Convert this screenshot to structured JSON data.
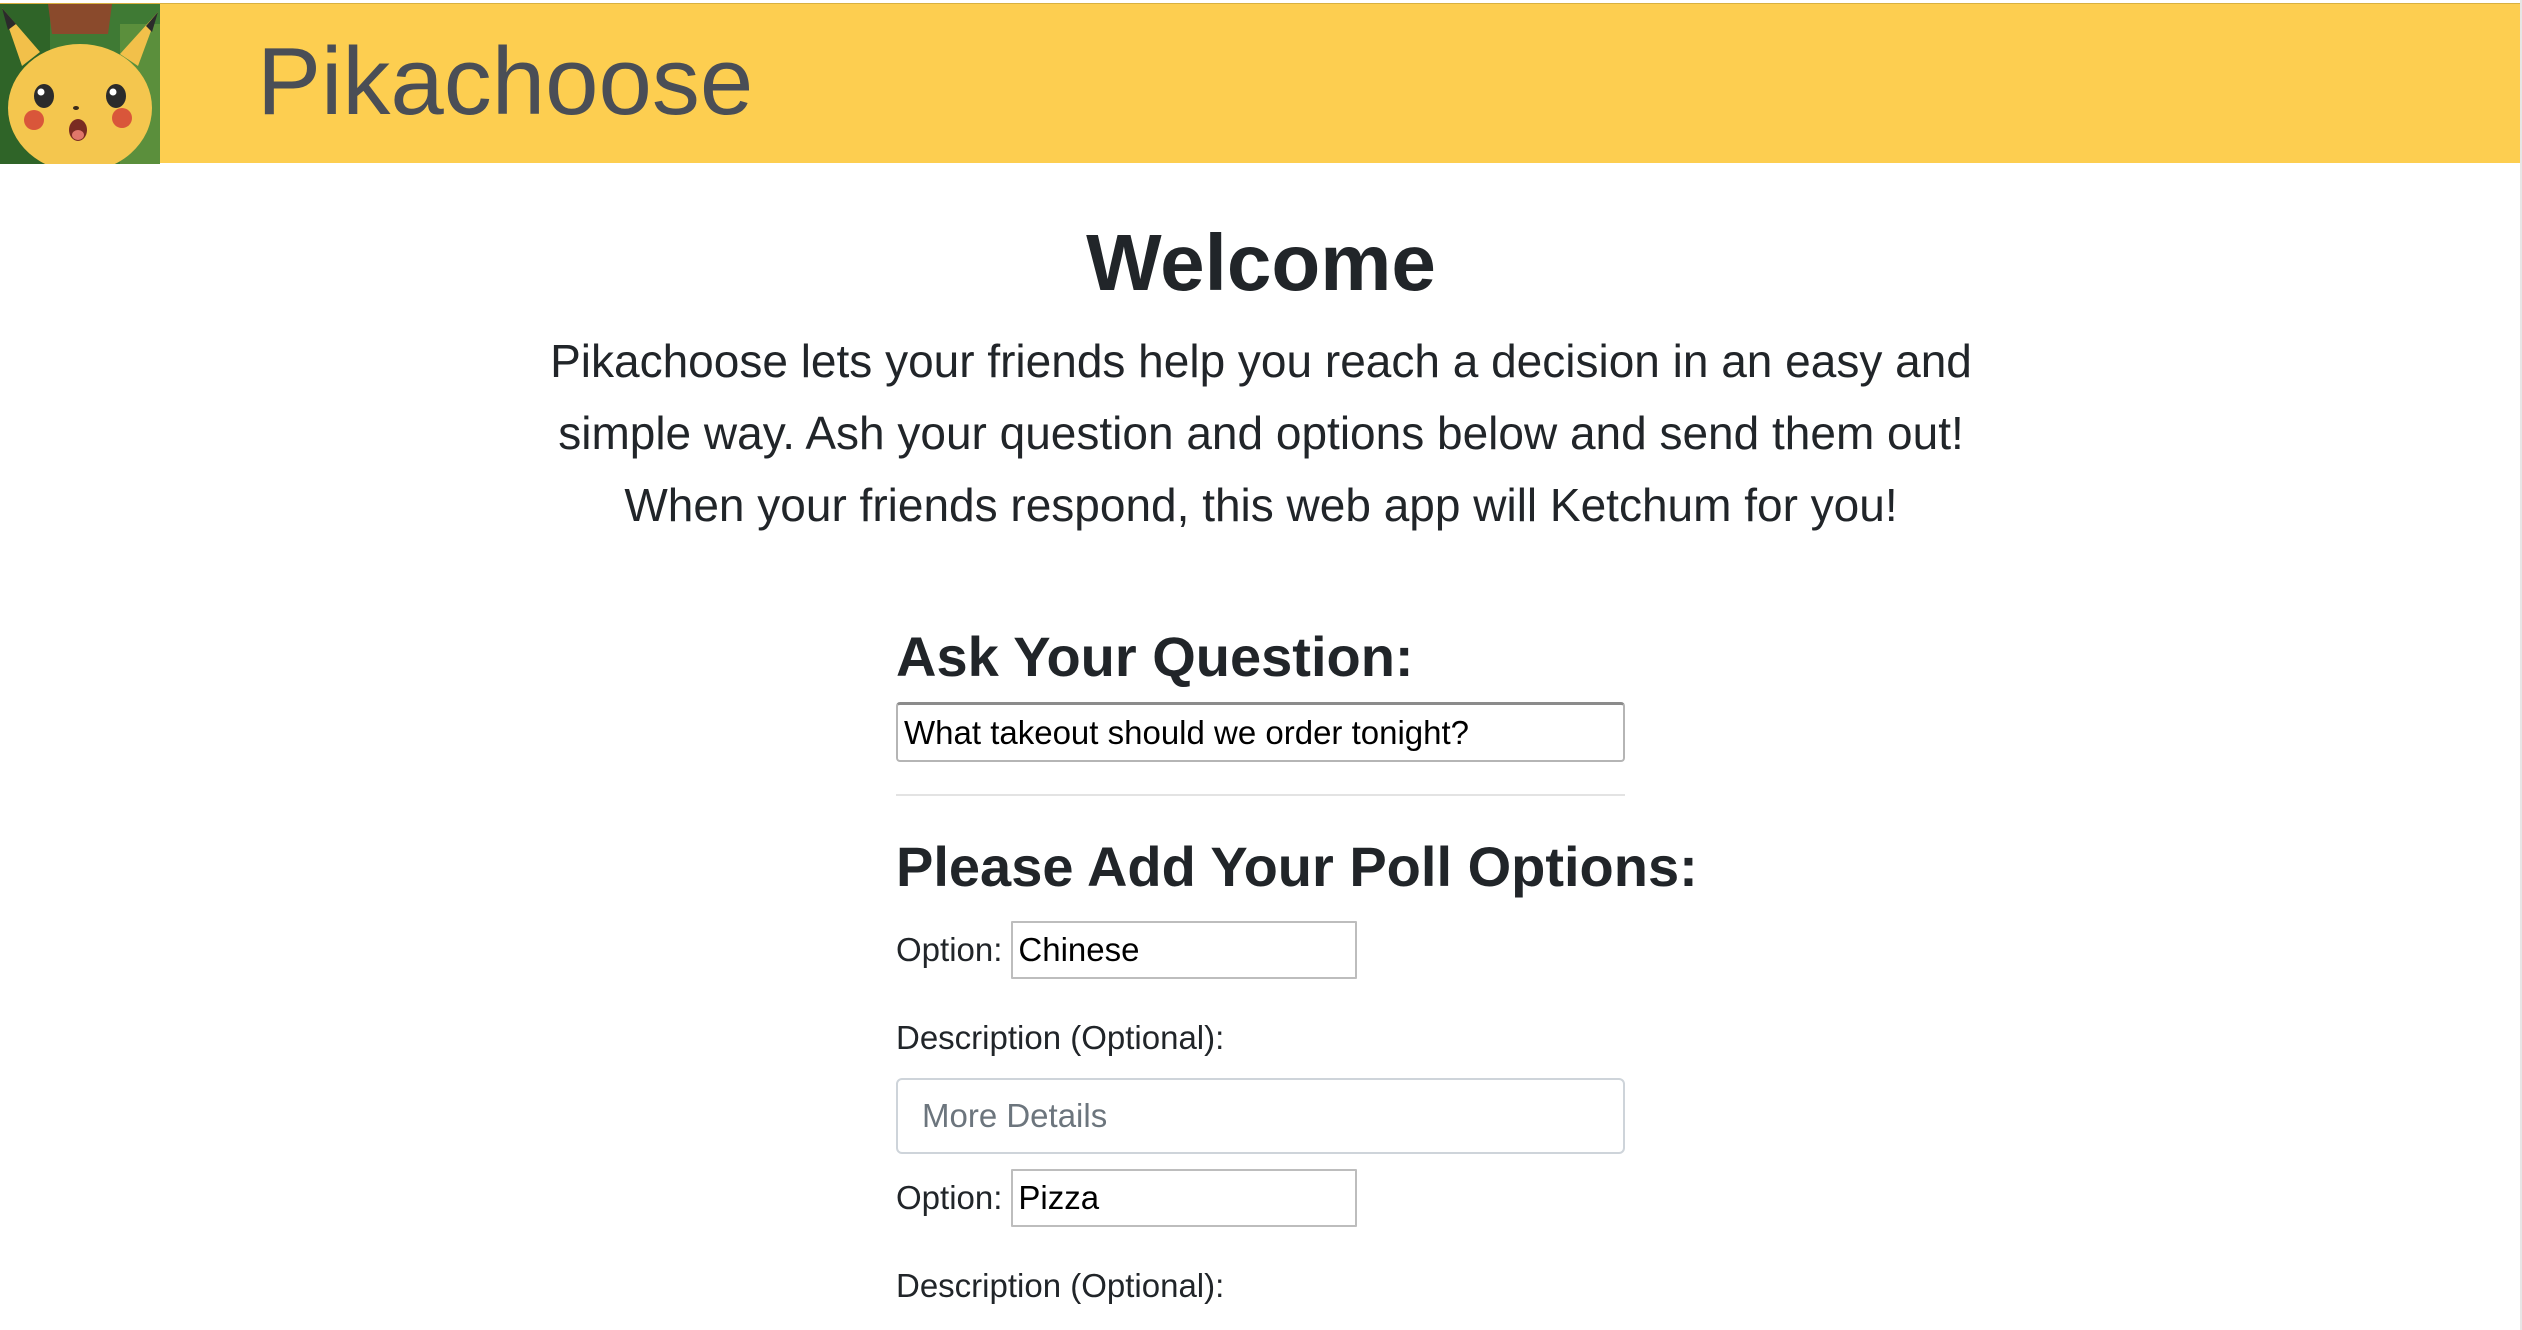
{
  "header": {
    "brand": "Pikachoose",
    "logo_icon": "pikachu-face-icon",
    "background_color": "#fdce50"
  },
  "intro": {
    "title": "Welcome",
    "line1": "Pikachoose lets your friends help you reach a decision in an easy and",
    "line2": "simple way. Ash your question and options below and send them out!",
    "line3": "When your friends respond, this web app will Ketchum for you!"
  },
  "question": {
    "heading": "Ask Your Question:",
    "value": "What takeout should we order tonight?"
  },
  "options": {
    "heading": "Please Add Your Poll Options:",
    "items": [
      {
        "label": "Option:",
        "value": "Chinese",
        "description_label": "Description (Optional):",
        "description_placeholder": "More Details"
      },
      {
        "label": "Option:",
        "value": "Pizza",
        "description_label": "Description (Optional):"
      }
    ]
  }
}
